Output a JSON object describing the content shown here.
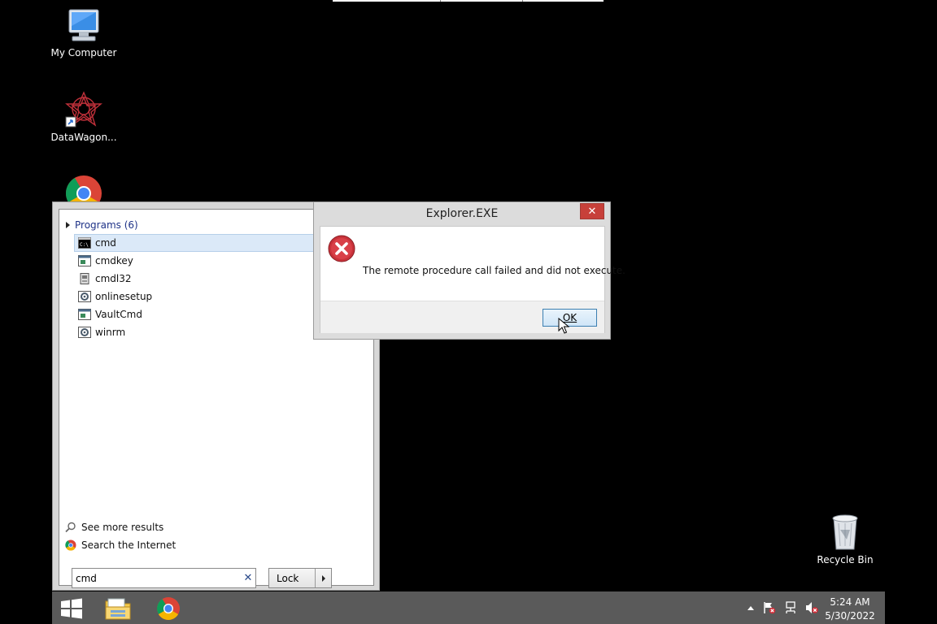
{
  "desktop": {
    "icons": [
      {
        "label": "My Computer"
      },
      {
        "label": "DataWagon..."
      },
      {
        "label": "Recycle Bin"
      }
    ]
  },
  "start_menu": {
    "group_label": "Programs (6)",
    "items": [
      {
        "label": "cmd"
      },
      {
        "label": "cmdkey"
      },
      {
        "label": "cmdl32"
      },
      {
        "label": "onlinesetup"
      },
      {
        "label": "VaultCmd"
      },
      {
        "label": "winrm"
      }
    ],
    "see_more": "See more results",
    "search_internet": "Search the Internet",
    "search_value": "cmd",
    "power_button": "Lock"
  },
  "dialog": {
    "title": "Explorer.EXE",
    "message": "The remote procedure call failed and did not execute.",
    "ok_label": "OK",
    "close_glyph": "✕"
  },
  "taskbar": {
    "time": "5:24 AM",
    "date": "5/30/2022"
  },
  "colors": {
    "accent_red": "#c7403a",
    "selection": "#dbe9f8",
    "taskbar": "#5a5a5a",
    "group_link": "#1e3287"
  }
}
